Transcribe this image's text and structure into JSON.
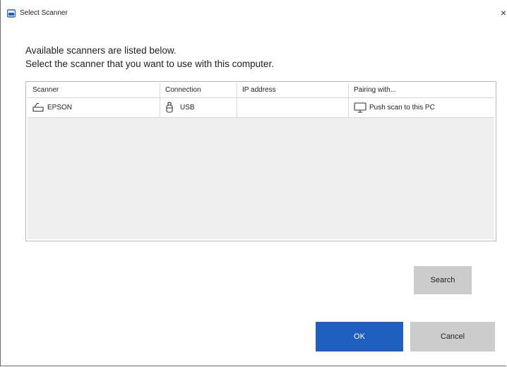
{
  "window": {
    "title": "Select Scanner",
    "close_glyph": "×"
  },
  "instructions": {
    "line1": "Available scanners are listed below.",
    "line2": "Select the scanner that you want to use with this computer."
  },
  "table": {
    "columns": [
      "Scanner",
      "Connection",
      "IP address",
      "Pairing with..."
    ],
    "rows": [
      {
        "scanner": "EPSON",
        "scanner_icon": "scanner-icon",
        "connection": "USB",
        "connection_icon": "usb-icon",
        "ip_address": "",
        "pairing": "Push scan to this PC",
        "pairing_icon": "monitor-icon"
      }
    ]
  },
  "buttons": {
    "search": "Search",
    "ok": "OK",
    "cancel": "Cancel"
  },
  "colors": {
    "accent": "#1f5fbd",
    "button_gray": "#cccccc",
    "list_background": "#efefef"
  }
}
